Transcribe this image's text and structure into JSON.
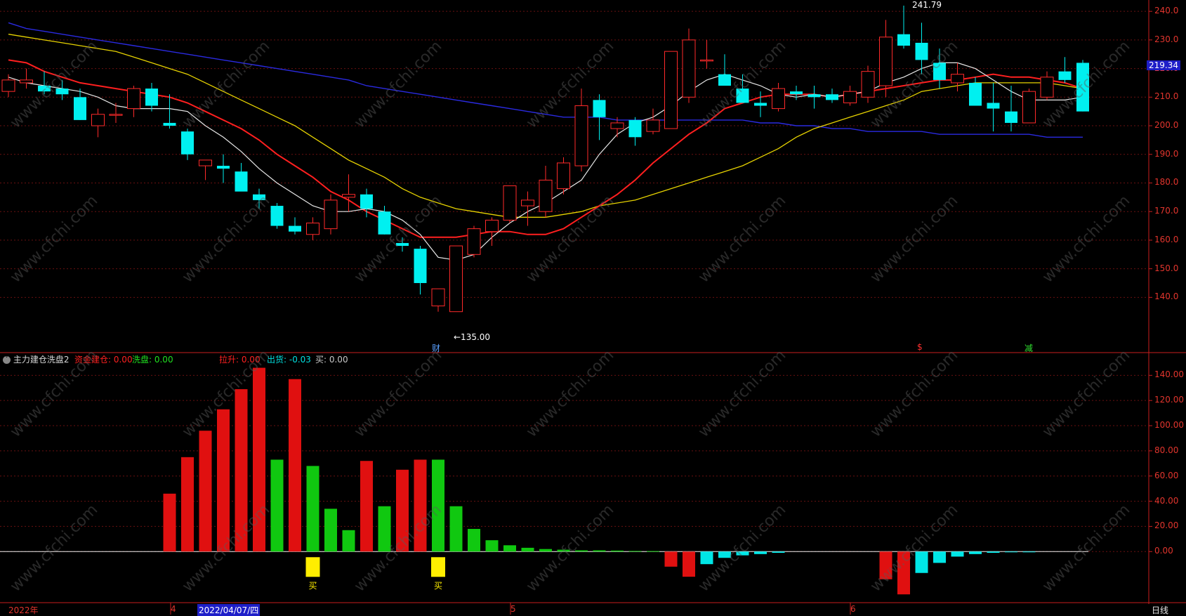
{
  "colors": {
    "up": "#ff2a2a",
    "down": "#00f0f0",
    "ma5": "#e8e8e8",
    "ma10": "#ff1f1f",
    "ma20": "#e6d200",
    "ma60": "#2a2ae0",
    "axis": "#c81e1e",
    "bar_red": "#e01010",
    "bar_green": "#10c810",
    "bar_cyan": "#00e6e6",
    "buy": "#ffee00"
  },
  "watermark": "www.cfchi.com",
  "price_panel": {
    "ticks": [
      "240.0",
      "230.0",
      "220.0",
      "210.0",
      "200.0",
      "190.0",
      "180.0",
      "170.0",
      "160.0",
      "150.0",
      "140.0"
    ],
    "current_price": "219.34",
    "high_label": "241.79",
    "low_label": "←135.00",
    "event_marks": [
      {
        "text": "财",
        "color": "#5aa0ff"
      },
      {
        "text": "$",
        "color": "#ff3030"
      },
      {
        "text": "减",
        "color": "#30e030"
      }
    ]
  },
  "indicator_panel": {
    "name": "主力建仓洗盘2",
    "fields": [
      {
        "label": "资金建仓:",
        "value": "0.00",
        "color": "#ff2020"
      },
      {
        "label": "洗盘:",
        "value": "0.00",
        "color": "#20e020"
      },
      {
        "label": "拉升:",
        "value": "0.00",
        "color": "#ff2020"
      },
      {
        "label": "出货:",
        "value": "-0.03",
        "color": "#00e0e0"
      },
      {
        "label": "买:",
        "value": "0.00",
        "color": "#c8c8c8"
      }
    ],
    "ticks": [
      "140.00",
      "120.00",
      "100.00",
      "80.00",
      "60.00",
      "40.00",
      "20.00",
      "0.00"
    ],
    "buy_label": "买"
  },
  "bottom_axis": {
    "year": "2022年",
    "m4": "4",
    "cursor_date": "2022/04/07/四",
    "m5": "5",
    "m6": "6",
    "period": "日线"
  },
  "chart_data": {
    "type": "candlestick",
    "ylim": [
      131,
      242
    ],
    "candles": [
      [
        212,
        218,
        210,
        216
      ],
      [
        215,
        220,
        213,
        216
      ],
      [
        214,
        219,
        211,
        212
      ],
      [
        213,
        216,
        209,
        211
      ],
      [
        210,
        213,
        202,
        202
      ],
      [
        200,
        206,
        196,
        204
      ],
      [
        204,
        208,
        201,
        204
      ],
      [
        206,
        214,
        203,
        213
      ],
      [
        213,
        215,
        205,
        207
      ],
      [
        201,
        211,
        199,
        200
      ],
      [
        198,
        199,
        188,
        190
      ],
      [
        186,
        188,
        181,
        188
      ],
      [
        186,
        190,
        180,
        185
      ],
      [
        184,
        187,
        179,
        177
      ],
      [
        176,
        178,
        171,
        174
      ],
      [
        172,
        173,
        164,
        165
      ],
      [
        165,
        168,
        162,
        163
      ],
      [
        162,
        168,
        160,
        166
      ],
      [
        164,
        176,
        162,
        174
      ],
      [
        175,
        183,
        170,
        176
      ],
      [
        176,
        178,
        168,
        171
      ],
      [
        170,
        172,
        162,
        162
      ],
      [
        159,
        161,
        156,
        158
      ],
      [
        157,
        158,
        141,
        145
      ],
      [
        137,
        143,
        135,
        143
      ],
      [
        135,
        158,
        135,
        158
      ],
      [
        155,
        165,
        154,
        164
      ],
      [
        163,
        168,
        158,
        167
      ],
      [
        167,
        179,
        166,
        179
      ],
      [
        172,
        177,
        165,
        174
      ],
      [
        170,
        186,
        168,
        181
      ],
      [
        178,
        189,
        176,
        187
      ],
      [
        186,
        213,
        184,
        207
      ],
      [
        209,
        211,
        195,
        203
      ],
      [
        199,
        203,
        196,
        201
      ],
      [
        202,
        203,
        193,
        196
      ],
      [
        198,
        206,
        197,
        202
      ],
      [
        199,
        224,
        199,
        226
      ],
      [
        210,
        234,
        208,
        230
      ],
      [
        223,
        230,
        220,
        223
      ],
      [
        218,
        225,
        214,
        214
      ],
      [
        213,
        218,
        209,
        208
      ],
      [
        208,
        212,
        203,
        207
      ],
      [
        206,
        215,
        205,
        213
      ],
      [
        212,
        214,
        209,
        211
      ],
      [
        211,
        214,
        206,
        210
      ],
      [
        211,
        213,
        208,
        209
      ],
      [
        208,
        214,
        207,
        212
      ],
      [
        210,
        221,
        208,
        219
      ],
      [
        214,
        237,
        210,
        231
      ],
      [
        232,
        242,
        227,
        228
      ],
      [
        229,
        236,
        218,
        223
      ],
      [
        222,
        227,
        213,
        216
      ],
      [
        215,
        222,
        212,
        218
      ],
      [
        215,
        217,
        209,
        207
      ],
      [
        208,
        215,
        198,
        206
      ],
      [
        205,
        214,
        198,
        201
      ],
      [
        201,
        213,
        201,
        212
      ],
      [
        210,
        219,
        209,
        217
      ],
      [
        219,
        224,
        215,
        216
      ],
      [
        222,
        223,
        205,
        205
      ]
    ],
    "ma5": [
      217,
      215,
      214,
      213,
      212,
      210,
      207,
      206,
      206,
      206,
      205,
      200,
      196,
      191,
      185,
      180,
      176,
      172,
      170,
      170,
      171,
      170,
      167,
      162,
      154,
      153,
      155,
      161,
      166,
      170,
      173,
      177,
      181,
      190,
      197,
      201,
      203,
      207,
      212,
      216,
      218,
      216,
      214,
      211,
      210,
      211,
      210,
      211,
      212,
      215,
      217,
      220,
      222,
      222,
      220,
      216,
      212,
      209,
      209,
      209,
      210
    ],
    "ma10": [
      223,
      222,
      219,
      217,
      215,
      214,
      213,
      212,
      211,
      210,
      208,
      205,
      202,
      199,
      195,
      190,
      186,
      182,
      177,
      174,
      170,
      167,
      164,
      161,
      161,
      161,
      162,
      163,
      163,
      162,
      162,
      164,
      168,
      172,
      176,
      181,
      187,
      192,
      197,
      201,
      206,
      208,
      210,
      211,
      211,
      211,
      210,
      211,
      212,
      213,
      214,
      215,
      216,
      216,
      217,
      218,
      217,
      217,
      216,
      215,
      213
    ],
    "ma20": [
      232,
      231,
      230,
      229,
      228,
      227,
      226,
      224,
      222,
      220,
      218,
      215,
      212,
      209,
      206,
      203,
      200,
      196,
      192,
      188,
      185,
      182,
      178,
      175,
      173,
      171,
      170,
      169,
      168,
      168,
      168,
      169,
      170,
      172,
      173,
      174,
      176,
      178,
      180,
      182,
      184,
      186,
      189,
      192,
      196,
      199,
      201,
      203,
      205,
      207,
      209,
      212,
      213,
      214,
      215,
      215,
      215,
      215,
      215,
      214,
      213
    ],
    "ma60": [
      236,
      234,
      233,
      232,
      231,
      230,
      229,
      228,
      227,
      226,
      225,
      224,
      223,
      222,
      221,
      220,
      219,
      218,
      217,
      216,
      214,
      213,
      212,
      211,
      210,
      209,
      208,
      207,
      206,
      205,
      204,
      203,
      203,
      203,
      202,
      202,
      202,
      202,
      202,
      202,
      202,
      202,
      201,
      201,
      200,
      200,
      199,
      199,
      198,
      198,
      198,
      198,
      197,
      197,
      197,
      197,
      197,
      197,
      196,
      196,
      196
    ],
    "indicator": {
      "ylim": [
        -35,
        148
      ],
      "series": [
        {
          "name": "资金建仓",
          "values": [
            [
              9,
              46
            ],
            [
              10,
              75
            ],
            [
              11,
              96
            ],
            [
              12,
              113
            ],
            [
              13,
              129
            ],
            [
              14,
              146
            ],
            [
              16,
              137
            ],
            [
              20,
              72
            ],
            [
              22,
              65
            ],
            [
              23,
              73
            ]
          ]
        },
        {
          "name": "洗盘",
          "values": [
            [
              15,
              73
            ],
            [
              17,
              68
            ],
            [
              18,
              34
            ],
            [
              19,
              17
            ],
            [
              21,
              36
            ],
            [
              24,
              73
            ],
            [
              25,
              36
            ],
            [
              26,
              18
            ],
            [
              27,
              9
            ],
            [
              28,
              5
            ],
            [
              29,
              3
            ],
            [
              30,
              2
            ],
            [
              31,
              1.5
            ],
            [
              32,
              1
            ],
            [
              33,
              1
            ],
            [
              34,
              0.8
            ],
            [
              35,
              0.5
            ],
            [
              36,
              0.4
            ]
          ]
        },
        {
          "name": "出货",
          "values": [
            [
              37,
              -12
            ],
            [
              38,
              -20
            ],
            [
              39,
              -10
            ],
            [
              40,
              -5
            ],
            [
              41,
              -3
            ],
            [
              42,
              -2
            ],
            [
              43,
              -1
            ],
            [
              49,
              -22
            ],
            [
              50,
              -34
            ],
            [
              51,
              -17
            ],
            [
              52,
              -9
            ],
            [
              53,
              -4
            ],
            [
              54,
              -2
            ],
            [
              55,
              -1
            ],
            [
              56,
              -0.5
            ],
            [
              57,
              -0.3
            ]
          ]
        }
      ],
      "buy_signals": [
        17,
        24
      ]
    }
  }
}
